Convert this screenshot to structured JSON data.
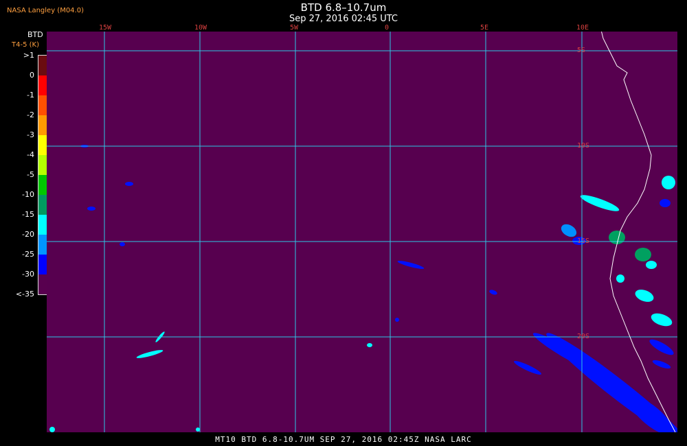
{
  "header": {
    "org": "NASA Langley (M04.0)",
    "title": "BTD 6.8–10.7um",
    "subtitle": "Sep 27, 2016 02:45 UTC"
  },
  "legend": {
    "label": "BTD",
    "unit": "T4-5 (K)",
    "ticks": [
      ">1",
      "0",
      "-1",
      "-2",
      "-3",
      "-4",
      "-5",
      "-10",
      "-15",
      "-20",
      "-25",
      "-30",
      "<-35"
    ],
    "colors": [
      "#6a0c10",
      "#ff0000",
      "#ff5000",
      "#ff9b00",
      "#ffff00",
      "#b5ff00",
      "#00c800",
      "#009a60",
      "#00ffff",
      "#0096ff",
      "#0000ff",
      "#58004f"
    ]
  },
  "grid": {
    "lon_labels": [
      "15W",
      "10W",
      "5W",
      "0",
      "5E",
      "10E"
    ],
    "lat_labels": [
      "5S",
      "10S",
      "15S",
      "20S"
    ],
    "line_color": "#2ec7e6"
  },
  "colors": {
    "background": "#57004f",
    "coast": "#ffffff"
  },
  "footer": "MT10  BTD 6.8-10.7UM   SEP 27, 2016 02:45Z   NASA LARC"
}
